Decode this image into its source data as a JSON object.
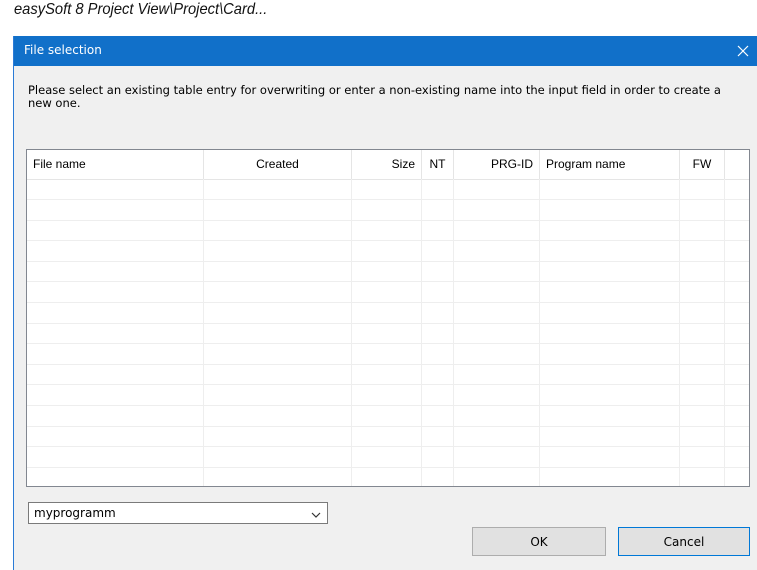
{
  "caption": "easySoft 8 Project View\\Project\\Card...",
  "dialog": {
    "title": "File selection",
    "instruction": "Please select an existing table entry for overwriting or enter a non-existing name into the input field in order to create a new one."
  },
  "table": {
    "columns": [
      "File name",
      "Created",
      "Size",
      "NT",
      "PRG-ID",
      "Program name",
      "FW",
      ""
    ],
    "rows": []
  },
  "combo": {
    "value": "myprogramm"
  },
  "buttons": {
    "ok": "OK",
    "cancel": "Cancel"
  },
  "icons": {
    "close": "close-icon",
    "dropdown": "chevron-down-icon"
  },
  "colors": {
    "titlebar": "#1170c9",
    "dialog_bg": "#f0f0f0",
    "focus_border": "#0078d7"
  }
}
